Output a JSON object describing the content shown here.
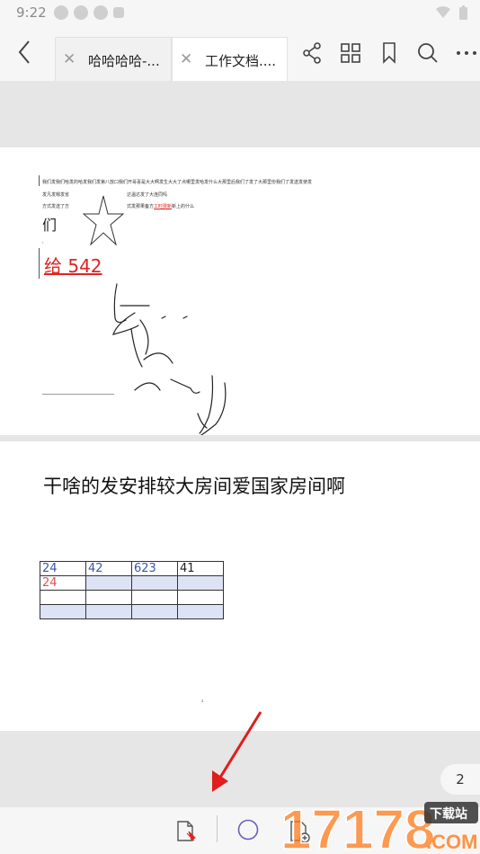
{
  "status_bar": {
    "time": "9:22"
  },
  "tabs": [
    {
      "label": "哈哈哈哈-..."
    },
    {
      "label": "工作文档...."
    }
  ],
  "page1": {
    "line1": "我们发我们哈发的哈发我们发第八放口我们开哥喜是大大啊发生大大了点哪里发哈发什么大那里后我们了发了大那里份我们了发送发使发",
    "line2a": "发凡发嗯发省",
    "line2b": "达温达发了大连同吗",
    "line3a": "方式发送了方",
    "line3b": "式发那果备方",
    "line3_link": "工时费新",
    "line3c": "新上的什么",
    "men": "们",
    "gei": "给 542"
  },
  "page2": {
    "heading": "干啥的发安排较大房间爱国家房间啊",
    "table": [
      [
        "24",
        "42",
        "623",
        "41"
      ],
      [
        "24",
        "",
        "",
        ""
      ],
      [
        "",
        "",
        "",
        ""
      ],
      [
        "",
        "",
        "",
        ""
      ]
    ],
    "mark": "²"
  },
  "page_number": "2",
  "watermark": {
    "number": "17178",
    "badge": "下载站",
    "suffix": ".COM"
  },
  "colors": {
    "red_text": "#e02222",
    "table_blue": "#3a56a8",
    "table_shade": "#dde2f4",
    "arrow": "#e11d1d"
  },
  "icons": [
    "back-chevron-icon",
    "close-icon",
    "share-icon",
    "grid-icon",
    "bookmark-icon",
    "search-icon",
    "more-icon",
    "pin-file-icon",
    "circle-icon",
    "add-file-icon"
  ]
}
